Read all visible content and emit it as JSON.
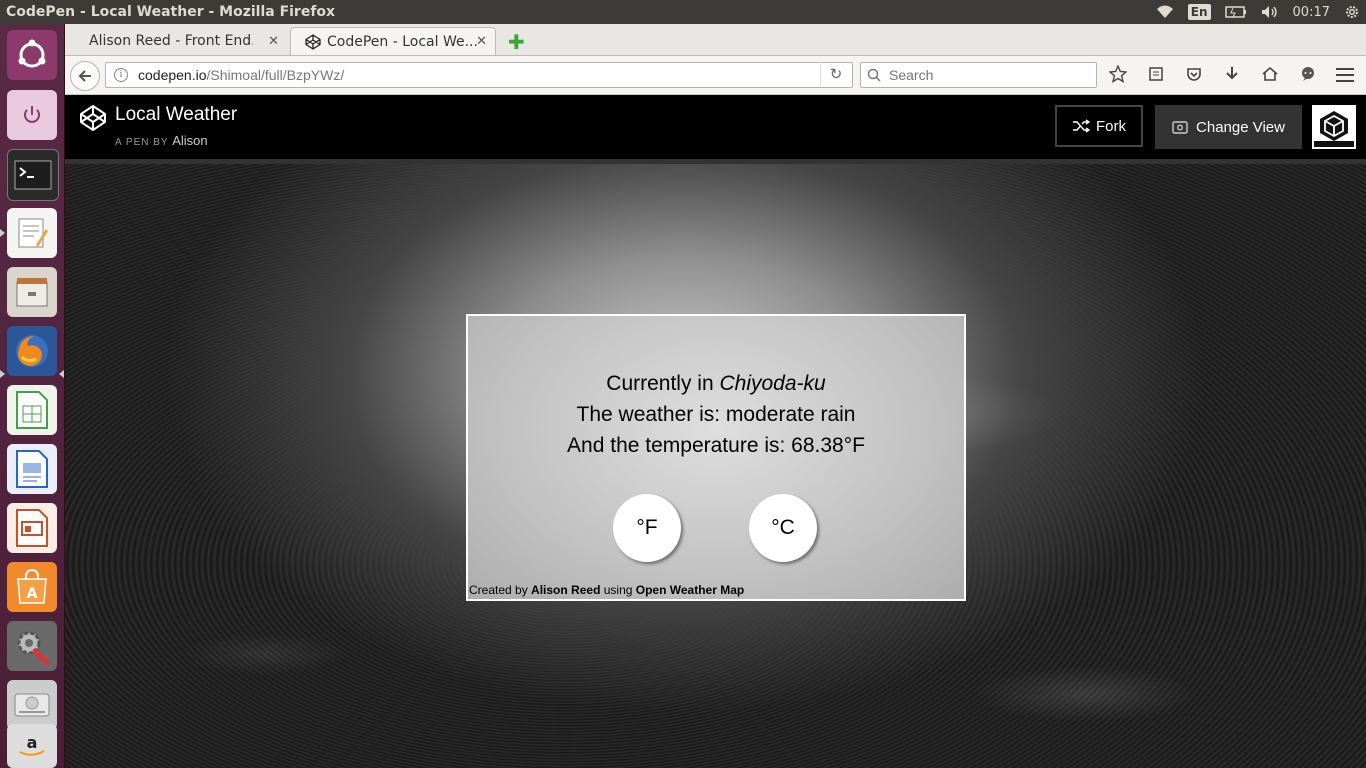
{
  "os": {
    "window_title": "CodePen - Local Weather - Mozilla Firefox",
    "keyboard_layout": "En",
    "clock": "00:17"
  },
  "launcher": {
    "items": [
      "ubuntu-dash-icon",
      "power-icon",
      "terminal-icon",
      "text-editor-icon",
      "files-icon",
      "firefox-icon",
      "spreadsheet-icon",
      "document-viewer-icon",
      "presentation-icon",
      "software-center-icon",
      "system-settings-icon",
      "disk-icon",
      "amazon-icon"
    ]
  },
  "browser": {
    "tabs": [
      {
        "label": "Alison Reed - Front End..."
      },
      {
        "label": "CodePen - Local We..."
      }
    ],
    "url_host": "codepen.io",
    "url_path": "/Shimoal/full/BzpYWz/",
    "search_placeholder": "Search"
  },
  "codepen": {
    "pen_title": "Local Weather",
    "byline_prefix": "A PEN BY",
    "author": "Alison",
    "fork_label": "Fork",
    "change_view_label": "Change View"
  },
  "weather": {
    "line1_prefix": "Currently in ",
    "location": "Chiyoda-ku",
    "line2": "The weather is: moderate rain",
    "line3": "And the temperature is: 68.38°F",
    "btn_f": "°F",
    "btn_c": "°C",
    "credit_prefix": "Created by ",
    "credit_author": "Alison Reed",
    "credit_mid": " using ",
    "credit_source": "Open Weather Map"
  },
  "colors": {
    "launcher_bg": "#4b1e38",
    "panel_bg": "#3c3b37",
    "codepen_header": "#000000",
    "new_tab_plus": "#3aa53a"
  }
}
